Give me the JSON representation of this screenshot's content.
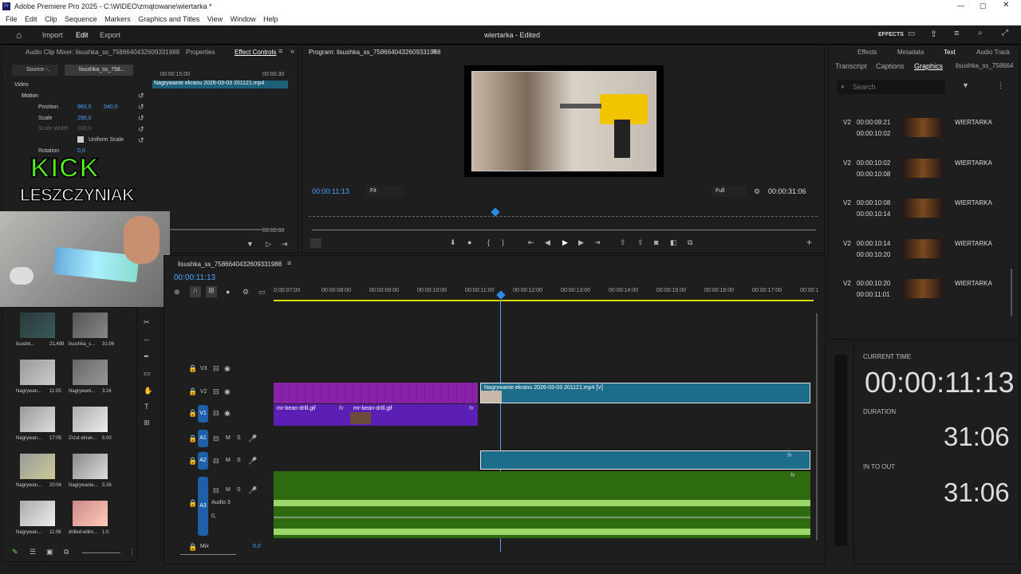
{
  "window": {
    "title": "Adobe Premiere Pro 2025 - C:\\WIDEO\\zmątowane\\wiertarka *"
  },
  "menu": [
    "File",
    "Edit",
    "Clip",
    "Sequence",
    "Markers",
    "Graphics and Titles",
    "View",
    "Window",
    "Help"
  ],
  "appbar": {
    "import": "Import",
    "edit": "Edit",
    "export": "Export",
    "project_title": "wiertarka - Edited",
    "effects_label": "EFFECTS"
  },
  "left_tabs": {
    "audio_mixer": "Audio Clip Mixer: lisushka_ss_7586640432609331988",
    "properties": "Properties",
    "effect_controls": "Effect Controls"
  },
  "effect_controls": {
    "source": "Source -..",
    "clip_name": "lisushka_ss_758...",
    "timecode_a": "00:00:15:00",
    "timecode_b": "00:00:30",
    "clip_label": "Nagrywanie ekranu 2026-03-03 201121.mp4",
    "video": "Video",
    "motion": "Motion",
    "position_label": "Position",
    "position_x": "960,0",
    "position_y": "540,0",
    "scale_label": "Scale",
    "scale_value": "290,0",
    "scale_width_label": "Scale Width",
    "scale_width_value": "100,0",
    "uniform_scale": "Uniform Scale",
    "rotation_label": "Rotation",
    "rotation_value": "0,0",
    "time_partial": "00:00:30"
  },
  "overlay": {
    "kick": "KICK",
    "streamer": "LESZCZYNIAK"
  },
  "program": {
    "title": "Program: lisushka_ss_7586640432609331988",
    "timecode": "00:00:11:13",
    "fit": "Fit",
    "full": "Full",
    "duration": "00:00:31:06"
  },
  "right_tabs": {
    "effects": "Effects",
    "metadata": "Metadata",
    "text": "Text",
    "audio_track": "Audio Track",
    "transcript": "Transcript",
    "captions": "Captions",
    "graphics": "Graphics",
    "clip": "lisushka_ss_758664",
    "search_placeholder": "Search"
  },
  "graphics": [
    {
      "track": "V2",
      "in": "00:00:09:21",
      "out": "00:00:10:02",
      "name": "WIERTARKA"
    },
    {
      "track": "V2",
      "in": "00:00:10:02",
      "out": "00:00:10:08",
      "name": "WIERTARKA"
    },
    {
      "track": "V2",
      "in": "00:00:10:08",
      "out": "00:00:10:14",
      "name": "WIERTARKA"
    },
    {
      "track": "V2",
      "in": "00:00:10:14",
      "out": "00:00:10:20",
      "name": "WIERTARKA"
    },
    {
      "track": "V2",
      "in": "00:00:10:20",
      "out": "00:00:11:01",
      "name": "WIERTARKA"
    }
  ],
  "info": {
    "current_time_label": "CURRENT TIME",
    "current_time": "00:00:11:13",
    "duration_label": "DURATION",
    "duration": "31:06",
    "in_to_out_label": "IN TO OUT",
    "in_to_out": "31:06"
  },
  "timeline": {
    "title": "lisushka_ss_7586640432609331988",
    "timecode": "00:00:11:13",
    "ticks": [
      "0:00:07:00",
      "00:00:08:00",
      "00:00:09:00",
      "00:00:10:00",
      "00:00:11:00",
      "00:00:12:00",
      "00:00:13:00",
      "00:00:14:00",
      "00:00:15:00",
      "00:00:16:00",
      "00:00:17:00",
      "00:00:1"
    ],
    "tracks": {
      "v3": "V3",
      "v2": "V2",
      "v1": "V1",
      "a1": "A1",
      "a2": "A2",
      "a3": "A3",
      "audio3": "Audio 3",
      "mix": "Mix",
      "mix_value": "0,0",
      "m": "M",
      "s": "S",
      "audio_value": "0,"
    },
    "clips": {
      "v2_clip": "Nagrywanie ekranu 2026-03-03 201121.mp4 [V]",
      "v1_clip_a": "mr-bean-drill.gif",
      "v1_clip_b": "mr-bean-drill.gif",
      "fx": "fx"
    }
  },
  "project_items": [
    {
      "name": "lisushk...",
      "dur": "21,498"
    },
    {
      "name": "lisushka_s...",
      "dur": "31:06"
    },
    {
      "name": "Nagrywan...",
      "dur": "11:05"
    },
    {
      "name": "Nagrywani...",
      "dur": "3:24"
    },
    {
      "name": "Nagrywan...",
      "dur": "17:05"
    },
    {
      "name": "Zrzut ekran...",
      "dur": "5:00"
    },
    {
      "name": "Nagrywan...",
      "dur": "20:04"
    },
    {
      "name": "Nagrywanie...",
      "dur": "5:26"
    },
    {
      "name": "Nagrywan...",
      "dur": "11:06"
    },
    {
      "name": "drilled-willm...",
      "dur": "1:0"
    }
  ],
  "colors": {
    "accent": "#2d8ceb",
    "v_clip_teal": "#1c6c8a",
    "gif_purple": "#5b1fb5",
    "gif_pink": "#8a22a8",
    "audio_green": "#2d6a10",
    "wave": "#9bd66a",
    "kick_green": "#53fc18"
  }
}
